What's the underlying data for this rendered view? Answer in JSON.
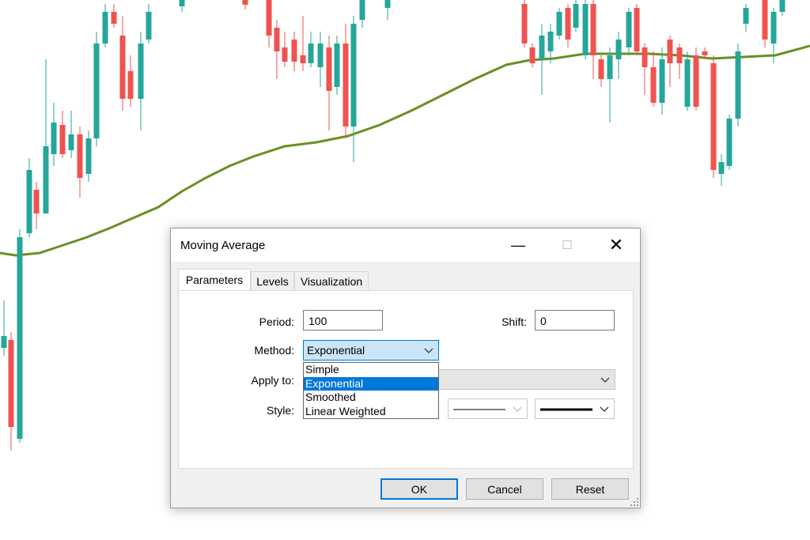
{
  "dialog": {
    "title": "Moving Average",
    "window_controls": {
      "minimize": "—",
      "maximize": "☐",
      "close": "✕"
    }
  },
  "tabs": [
    {
      "label": "Parameters",
      "active": true
    },
    {
      "label": "Levels",
      "active": false
    },
    {
      "label": "Visualization",
      "active": false
    }
  ],
  "parameters": {
    "period_label": "Period:",
    "period_value": "100",
    "shift_label": "Shift:",
    "shift_value": "0",
    "method_label": "Method:",
    "method_value": "Exponential",
    "apply_label": "Apply to:",
    "style_label": "Style:"
  },
  "method_options": [
    {
      "label": "Simple",
      "selected": false
    },
    {
      "label": "Exponential",
      "selected": true
    },
    {
      "label": "Smoothed",
      "selected": false
    },
    {
      "label": "Linear Weighted",
      "selected": false
    }
  ],
  "buttons": {
    "ok": "OK",
    "cancel": "Cancel",
    "reset": "Reset"
  },
  "colors": {
    "bull": "#26a69a",
    "bear": "#ef5350",
    "ma_line": "#6b8e23",
    "accent": "#0078d7"
  },
  "icons": {
    "dropdown": "chevron-down-icon",
    "resize": "resize-grip-icon"
  }
}
